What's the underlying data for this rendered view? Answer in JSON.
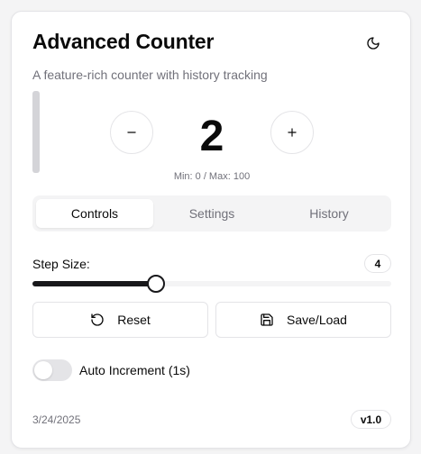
{
  "header": {
    "title": "Advanced Counter",
    "subtitle": "A feature-rich counter with history tracking",
    "theme_icon": "moon-icon"
  },
  "counter": {
    "value": "2",
    "range_text": "Min: 0 / Max: 100",
    "decrement_symbol": "−",
    "increment_symbol": "+"
  },
  "tabs": [
    {
      "label": "Controls",
      "active": true
    },
    {
      "label": "Settings",
      "active": false
    },
    {
      "label": "History",
      "active": false
    }
  ],
  "controls": {
    "step_label": "Step Size:",
    "step_value": "4",
    "step_fraction": 0.345,
    "reset_label": "Reset",
    "reset_icon": "rotate-ccw-icon",
    "save_label": "Save/Load",
    "save_icon": "save-icon",
    "auto_increment_label": "Auto Increment (1s)",
    "auto_increment_on": false
  },
  "footer": {
    "date": "3/24/2025",
    "version": "v1.0"
  },
  "colors": {
    "accent": "#18181b",
    "muted_text": "#71717a",
    "border": "#e4e4e7",
    "muted_bg": "#f4f4f5"
  }
}
